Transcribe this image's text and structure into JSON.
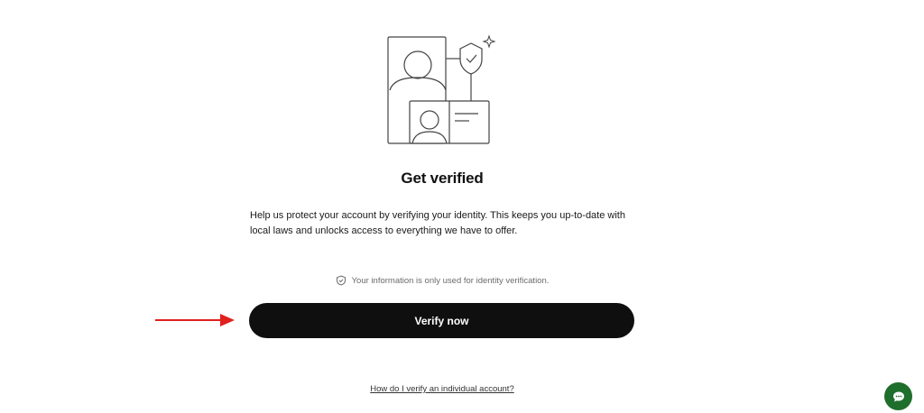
{
  "main": {
    "title": "Get verified",
    "description": "Help us protect your account by verifying your identity. This keeps you up-to-date with local laws and unlocks access to everything we have to offer.",
    "privacy_note": "Your information is only used for identity verification.",
    "verify_button_label": "Verify now",
    "help_link_text": "How do I verify an individual account?"
  },
  "icons": {
    "illustration": "identity-verification-illustration",
    "privacy": "shield-check-icon",
    "annotation": "red-arrow",
    "chat": "chat-bubble-icon"
  },
  "colors": {
    "button_bg": "#0f0f0f",
    "button_text": "#ffffff",
    "arrow": "#e0201e",
    "chat_bg": "#1e6e2c",
    "muted_text": "#6b6b6b"
  }
}
